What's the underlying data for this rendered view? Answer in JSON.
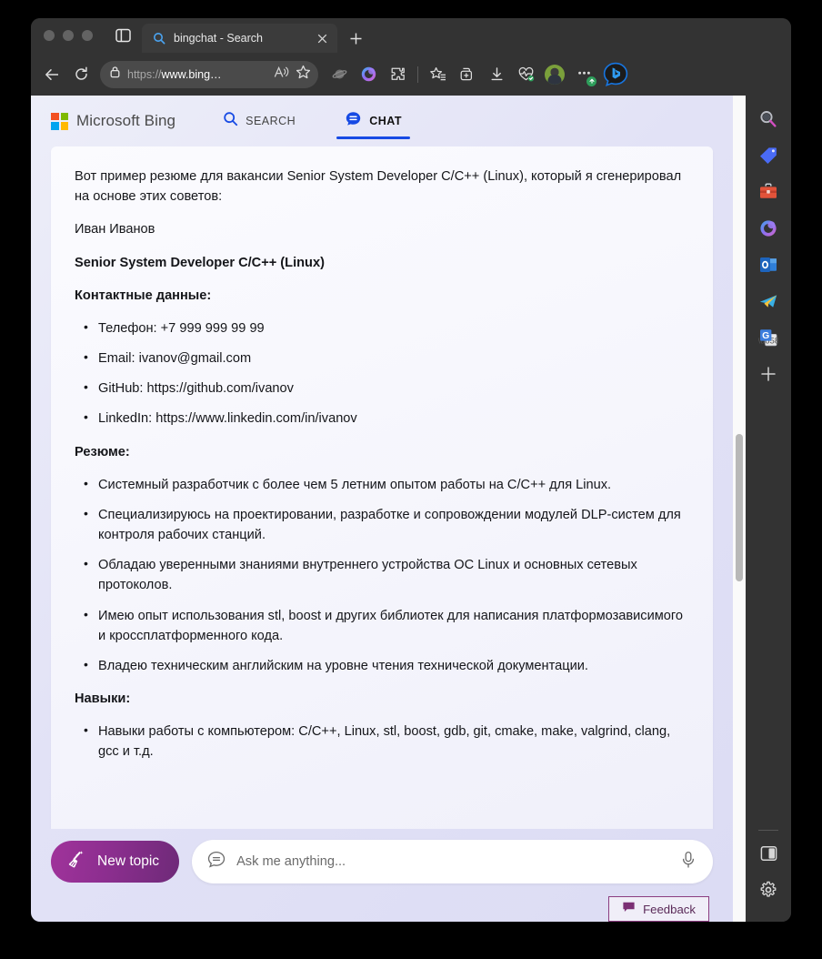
{
  "browser": {
    "tab": {
      "title": "bingchat - Search",
      "favicon_icon": "search-icon",
      "close_icon": "close-icon"
    },
    "new_tab_icon": "plus-icon",
    "sidebar_toggle_icon": "panel-toggle-icon",
    "toolbar": {
      "back_icon": "back-arrow-icon",
      "reload_icon": "reload-icon",
      "lock_icon": "lock-icon",
      "url_scheme": "https://",
      "url_host": "www.bing…",
      "read_aloud_icon": "read-aloud-icon",
      "favorite_icon": "star-icon",
      "saturn_icon": "planet-icon",
      "copilot_icon": "copilot-icon",
      "extensions_icon": "puzzle-icon",
      "collections_star_icon": "favorites-list-icon",
      "add_tab_group_icon": "tab-group-icon",
      "downloads_icon": "download-icon",
      "performance_icon": "heartbeat-icon",
      "profile_icon": "avatar",
      "more_icon": "ellipsis-icon",
      "more_badge_icon": "update-arrow-icon",
      "bing_chat_icon": "bing-chat-icon"
    }
  },
  "bing": {
    "logo_text": "Microsoft Bing",
    "logo_icon": "microsoft-squares-icon",
    "tabs": [
      {
        "label": "SEARCH",
        "icon": "search-icon",
        "active": false
      },
      {
        "label": "CHAT",
        "icon": "chat-bubble-icon",
        "active": true
      }
    ]
  },
  "chat": {
    "intro": "Вот пример резюме для вакансии Senior System Developer C/C++ (Linux), который я сгенерировал на основе этих советов:",
    "candidate_name": "Иван Иванов",
    "job_title": "Senior System Developer C/C++ (Linux)",
    "contacts_heading": "Контактные данные:",
    "contacts": [
      "Телефон: +7 999 999 99 99",
      "Email: ivanov@gmail.com",
      "GitHub: https://github.com/ivanov",
      "LinkedIn: https://www.linkedin.com/in/ivanov"
    ],
    "summary_heading": "Резюме:",
    "summary": [
      "Системный разработчик с более чем 5 летним опытом работы на C/C++ для Linux.",
      "Специализируюсь на проектировании, разработке и сопровождении модулей DLP-систем для контроля рабочих станций.",
      "Обладаю уверенными знаниями внутреннего устройства ОС Linux и основных сетевых протоколов.",
      "Имею опыт использования stl, boost и других библиотек для написания платформозависимого и кроссплатформенного кода.",
      "Владею техническим английским на уровне чтения технической документации."
    ],
    "skills_heading": "Навыки:",
    "skills": [
      "Навыки работы с компьютером: C/C++, Linux, stl, boost, gdb, git, cmake, make, valgrind, clang, gcc и т.д."
    ]
  },
  "composer": {
    "new_topic_label": "New topic",
    "new_topic_icon": "broom-icon",
    "input_icon": "chat-bubble-icon",
    "input_placeholder": "Ask me anything...",
    "input_value": "",
    "mic_icon": "microphone-icon"
  },
  "feedback": {
    "label": "Feedback",
    "icon": "feedback-flag-icon"
  },
  "edge_sidebar": {
    "items": [
      {
        "name": "search",
        "icon": "search-magnifier-icon"
      },
      {
        "name": "shopping",
        "icon": "price-tag-icon"
      },
      {
        "name": "tools",
        "icon": "briefcase-icon"
      },
      {
        "name": "office",
        "icon": "office-icon"
      },
      {
        "name": "outlook",
        "icon": "outlook-icon"
      },
      {
        "name": "telegram",
        "icon": "paper-plane-icon"
      },
      {
        "name": "translate",
        "icon": "google-translate-icon"
      },
      {
        "name": "add",
        "icon": "plus-icon"
      }
    ],
    "bottom_items": [
      {
        "name": "split-screen",
        "icon": "split-pane-icon"
      },
      {
        "name": "settings",
        "icon": "gear-icon"
      }
    ]
  },
  "colors": {
    "accent_blue": "#174ae4",
    "new_topic_gradient_from": "#a0339b",
    "new_topic_gradient_to": "#6e2a78",
    "feedback_border": "#8b3d80",
    "page_background": "#dcdcf4"
  }
}
